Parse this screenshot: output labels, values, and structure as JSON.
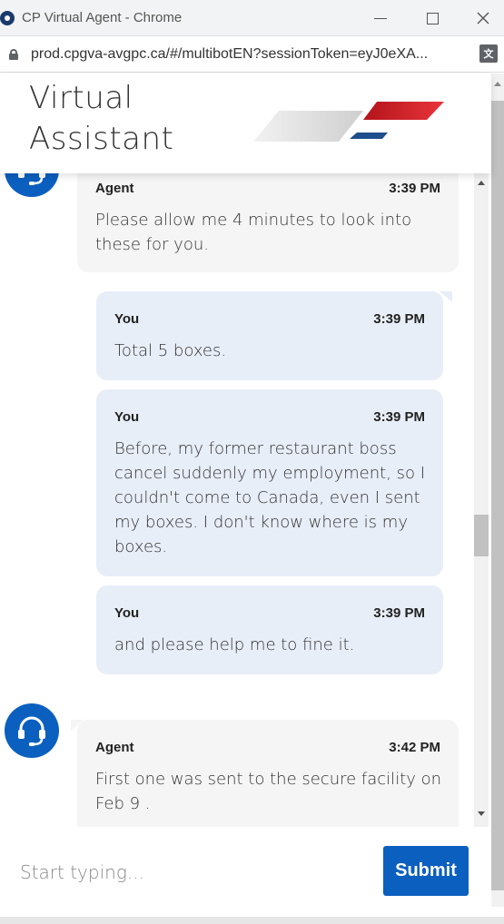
{
  "window": {
    "title": "CP Virtual Agent - Chrome",
    "url": "prod.cpgva-avgpc.ca/#/multibotEN?sessionToken=eyJ0eXA...",
    "translate_icon": "translate-icon",
    "favicon": "cp-favicon-icon"
  },
  "header": {
    "title_line1": "Virtual",
    "title_line2": "Assistant",
    "logo": "canada-post-logo"
  },
  "messages": [
    {
      "sender": "Agent",
      "time": "3:39 PM",
      "text": "Please allow me 4 minutes to look into these for you."
    },
    {
      "sender": "You",
      "time": "3:39 PM",
      "text": "Total 5 boxes."
    },
    {
      "sender": "You",
      "time": "3:39 PM",
      "text": "Before, my former restaurant boss cancel suddenly my employment, so I couldn't come to Canada, even I sent my boxes. I don't know where is my boxes."
    },
    {
      "sender": "You",
      "time": "3:39 PM",
      "text": "and please help me to fine it."
    },
    {
      "sender": "Agent",
      "time": "3:42 PM",
      "text": "First one was sent to the secure facility on Feb 9 ."
    }
  ],
  "composer": {
    "placeholder": "Start typing...",
    "submit_label": "Submit"
  },
  "colors": {
    "accent": "#0b5fbf",
    "you_bubble": "#e8eef8",
    "agent_bubble": "#f5f5f5",
    "logo_red": "#d7262b",
    "logo_blue": "#1f4e8c"
  }
}
